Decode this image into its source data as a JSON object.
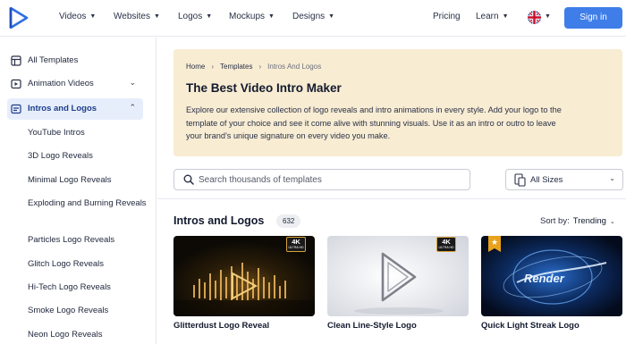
{
  "nav": {
    "items": [
      {
        "label": "Videos",
        "caret": "▼"
      },
      {
        "label": "Websites",
        "caret": "▼"
      },
      {
        "label": "Logos",
        "caret": "▼"
      },
      {
        "label": "Mockups",
        "caret": "▼"
      },
      {
        "label": "Designs",
        "caret": "▼"
      }
    ],
    "pricing": "Pricing",
    "learn": "Learn",
    "learn_caret": "▼",
    "flag_caret": "▼",
    "signin": "Sign in",
    "logo_icon": "play-triangle-logo-icon",
    "flag_icon": "uk-flag-icon"
  },
  "sidebar": {
    "top_items": [
      {
        "label": "All Templates",
        "icon": "template-grid-icon"
      },
      {
        "label": "Animation Videos",
        "icon": "video-play-icon",
        "chevron": "⌄"
      },
      {
        "label": "Intros and Logos",
        "icon": "intro-logo-icon",
        "chevron": "⌃"
      }
    ],
    "sub_items": [
      "YouTube Intros",
      "3D Logo Reveals",
      "Minimal Logo Reveals",
      "Exploding and Burning Reveals",
      "Particles Logo Reveals",
      "Glitch Logo Reveals",
      "Hi-Tech Logo Reveals",
      "Smoke Logo Reveals",
      "Neon Logo Reveals"
    ]
  },
  "banner": {
    "breadcrumb": [
      "Home",
      "Templates",
      "Intros And Logos"
    ],
    "separator": "›",
    "title": "The Best Video Intro Maker",
    "description": "Explore our extensive collection of logo reveals and intro animations in every style. Add your logo to the template of your choice and see it come alive with stunning visuals. Use it as an intro or outro to leave your brand’s unique signature on every video you make."
  },
  "search": {
    "placeholder": "Search thousands of templates",
    "value": ""
  },
  "size_filter": {
    "label": "All Sizes",
    "caret": "⌄"
  },
  "section": {
    "title": "Intros and Logos",
    "count": "632",
    "sort_label": "Sort by:",
    "sort_value": "Trending",
    "sort_caret": "⌄"
  },
  "cards": [
    {
      "title": "Glitterdust Logo Reveal",
      "badge": "4K",
      "badge_sub": "ULTRA HD"
    },
    {
      "title": "Clean Line-Style Logo",
      "badge": "4K",
      "badge_sub": "ULTRA HD"
    },
    {
      "title": "Quick Light Streak Logo",
      "star": "★",
      "thumb_text": "Render"
    }
  ],
  "colors": {
    "accent": "#3f7ee8",
    "banner_bg": "#f8ecd3",
    "active_bg": "#e7eefb",
    "badge_gold": "#d7a33a",
    "star_orange": "#e8a21c"
  }
}
